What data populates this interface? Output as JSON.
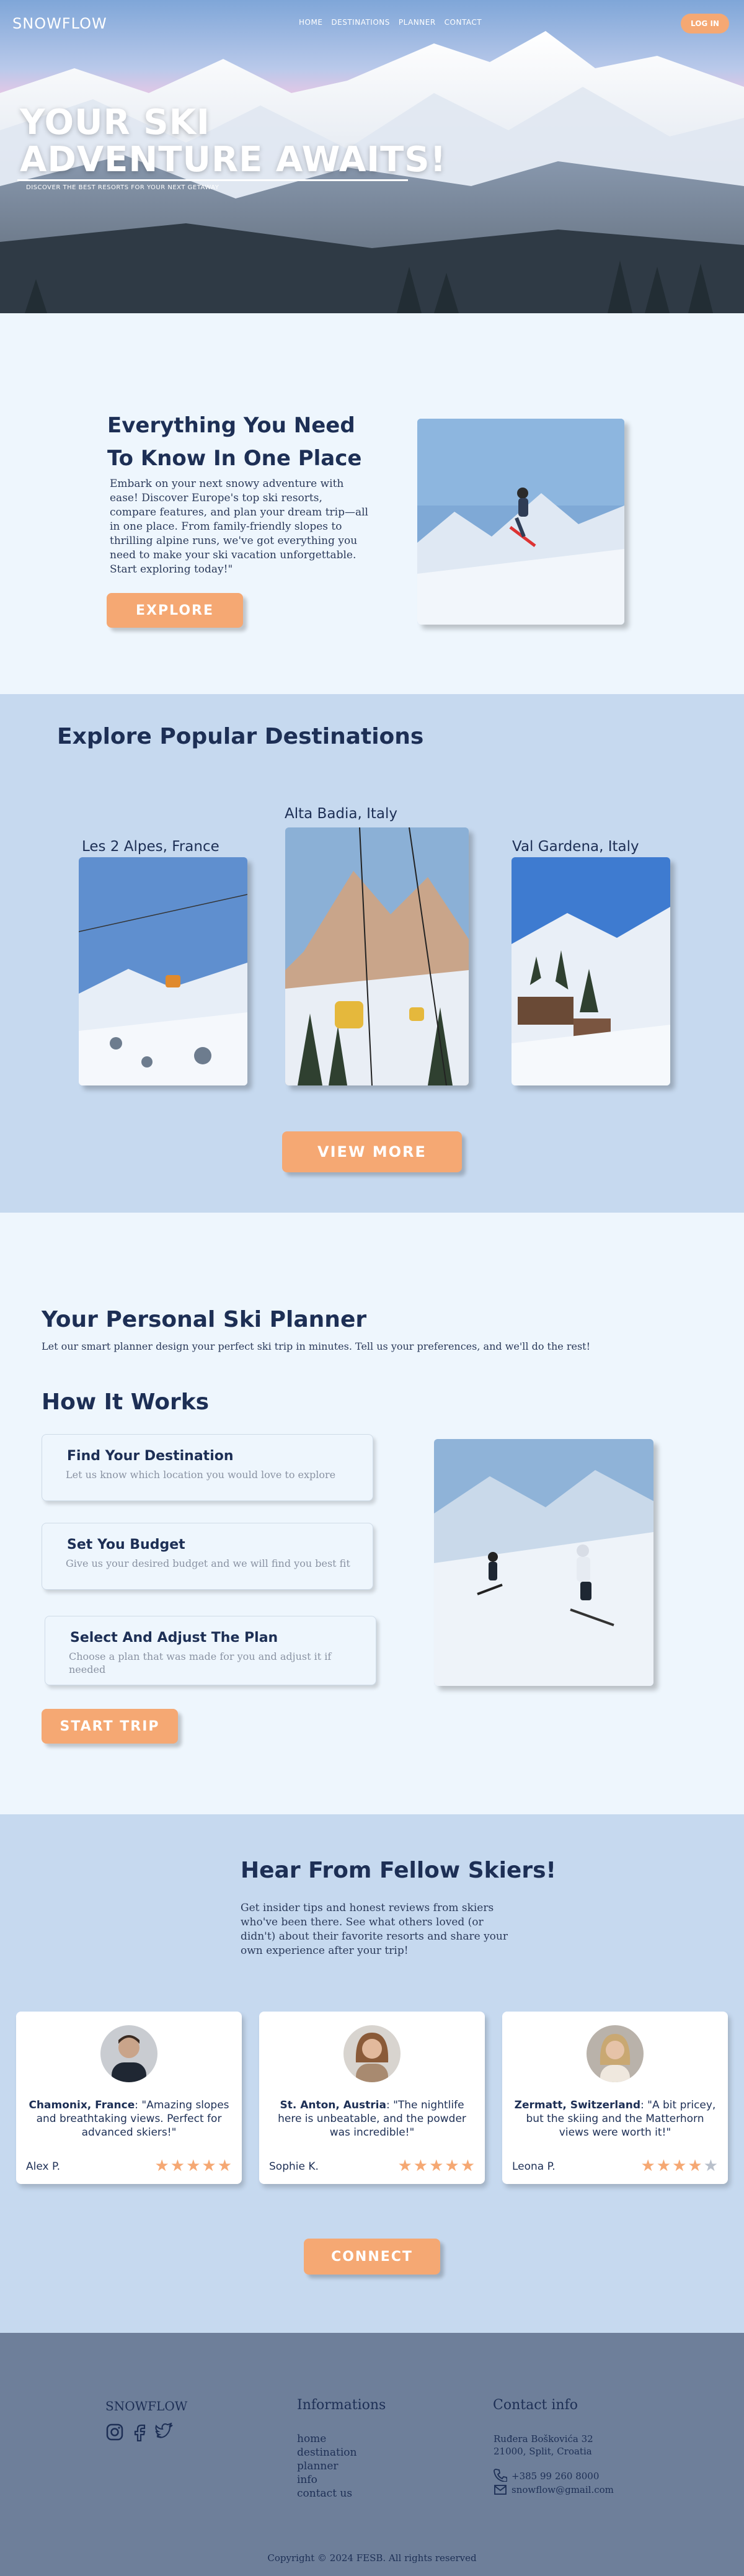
{
  "nav": {
    "logo": "SNOWFLOW",
    "links": [
      "HOME",
      "DESTINATIONS",
      "PLANNER",
      "CONTACT"
    ],
    "login": "LOG IN"
  },
  "hero": {
    "title_line1": "YOUR SKI",
    "title_line2": "ADVENTURE AWAITS!",
    "subtitle": "DISCOVER THE BEST RESORTS FOR YOUR NEXT GETAWAY"
  },
  "intro": {
    "heading": "Everything You Need To Know In One Place",
    "body": "Embark on your next snowy adventure with ease! Discover Europe's top ski resorts, compare features, and plan your dream trip—all in one place. From family-friendly slopes to thrilling alpine runs, we've got everything you need to make your ski vacation unforgettable. Start exploring today!\"",
    "button": "EXPLORE"
  },
  "destinations": {
    "heading": "Explore Popular Destinations",
    "items": [
      "Les 2 Alpes, France",
      "Alta Badia, Italy",
      "Val Gardena, Italy"
    ],
    "button": "VIEW MORE"
  },
  "planner": {
    "heading": "Your Personal Ski Planner",
    "lead": "Let our smart planner design your perfect ski trip in minutes. Tell us your preferences, and we'll do the rest!",
    "how_heading": "How It Works",
    "steps": [
      {
        "title": "Find Your Destination",
        "text": "Let us know which location you would love to explore"
      },
      {
        "title": "Set You Budget",
        "text": "Give us your desired budget and we will find you best fit"
      },
      {
        "title": "Select And Adjust The Plan",
        "text": "Choose a plan that was made for you and adjust it if needed"
      }
    ],
    "button": "START TRIP"
  },
  "testimonials": {
    "heading": "Hear From Fellow Skiers!",
    "lead": "Get insider tips and honest reviews from skiers who've been there. See what others loved (or didn't) about their favorite resorts and share your own experience after your trip!",
    "reviews": [
      {
        "place": "Chamonix, France",
        "quote": ": \"Amazing slopes and breathtaking views. Perfect for advanced skiers!\"",
        "author": "Alex P.",
        "rating": 5
      },
      {
        "place": "St. Anton, Austria",
        "quote": ": \"The nightlife here is unbeatable, and the powder was incredible!\"",
        "author": "Sophie K.",
        "rating": 5
      },
      {
        "place": "Zermatt, Switzerland",
        "quote": ": \"A bit pricey, but the skiing and the Matterhorn views were worth it!\"",
        "author": "Leona P.",
        "rating": 4
      }
    ],
    "button": "CONNECT"
  },
  "footer": {
    "brand": "SNOWFLOW",
    "social_icons": [
      "instagram-icon",
      "facebook-icon",
      "twitter-icon"
    ],
    "info_heading": "Informations",
    "info_links": [
      "home",
      "destination",
      "planner",
      "info",
      "contact us"
    ],
    "contact_heading": "Contact info",
    "address_line1": "Ruđera Boškovića 32",
    "address_line2": "21000, Split, Croatia",
    "phone": "+385 99 260 8000",
    "email": "snowflow@gmail.com",
    "copyright": "Copyright © 2024 FESB. All rights reserved"
  },
  "colors": {
    "accent": "#f5a873",
    "navy": "#1d2f55",
    "light_bg": "#eef6fd",
    "blue_bg": "#c6d9ef",
    "footer_bg": "#6e7f9a"
  }
}
